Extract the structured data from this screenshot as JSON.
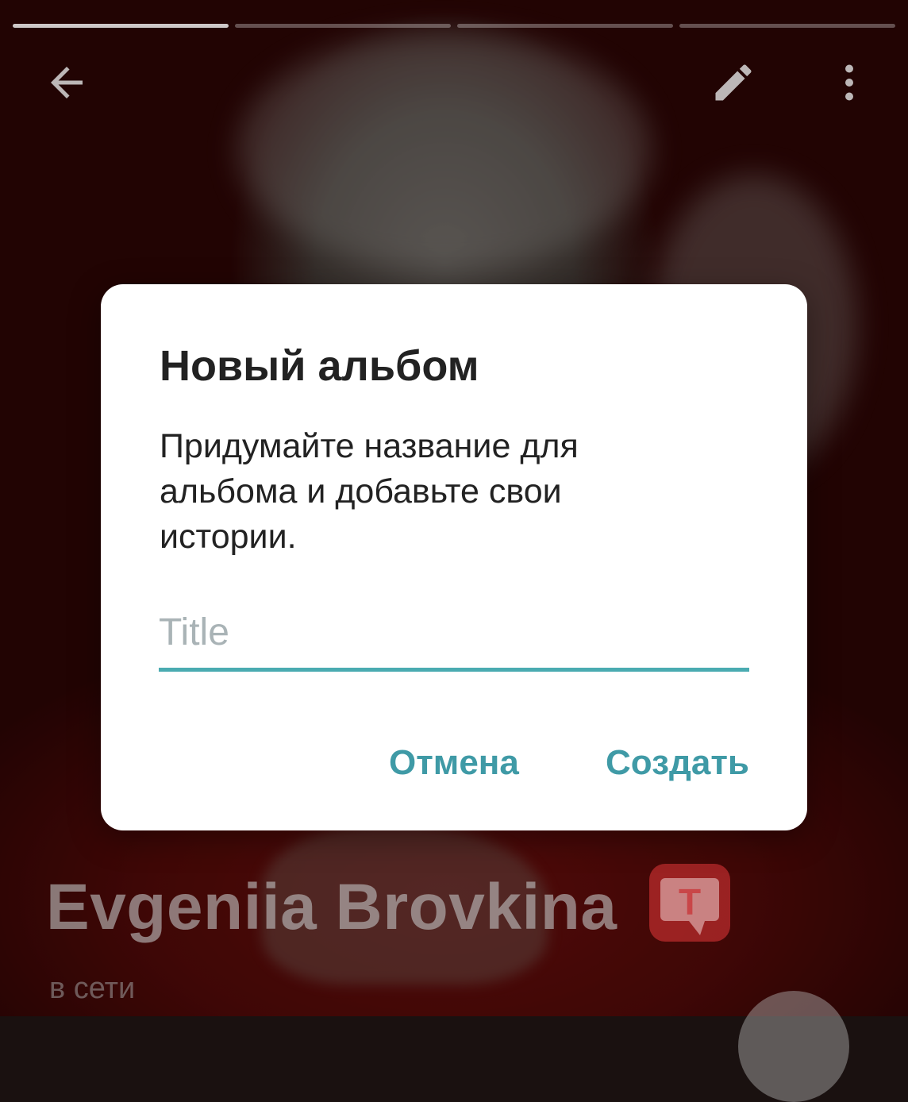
{
  "story_header": {
    "progress_segments": [
      {
        "state": "active"
      },
      {
        "state": "inactive"
      },
      {
        "state": "inactive"
      },
      {
        "state": "inactive"
      }
    ],
    "icons": {
      "back": "arrow-left-icon",
      "edit": "pencil-icon",
      "more": "more-vertical-icon"
    }
  },
  "profile": {
    "name": "Evgeniia Brovkina",
    "status": "в сети",
    "badge_letter": "T",
    "badge_color": "#e03a3e"
  },
  "dialog": {
    "title": "Новый альбом",
    "message": "Придумайте название для альбома и добавьте свои истории.",
    "input": {
      "placeholder": "Title",
      "value": ""
    },
    "buttons": {
      "cancel": "Отмена",
      "create": "Создать"
    }
  },
  "colors": {
    "accent": "#3f9aa6",
    "input_underline": "#4aabb1",
    "dialog_background": "#ffffff"
  }
}
